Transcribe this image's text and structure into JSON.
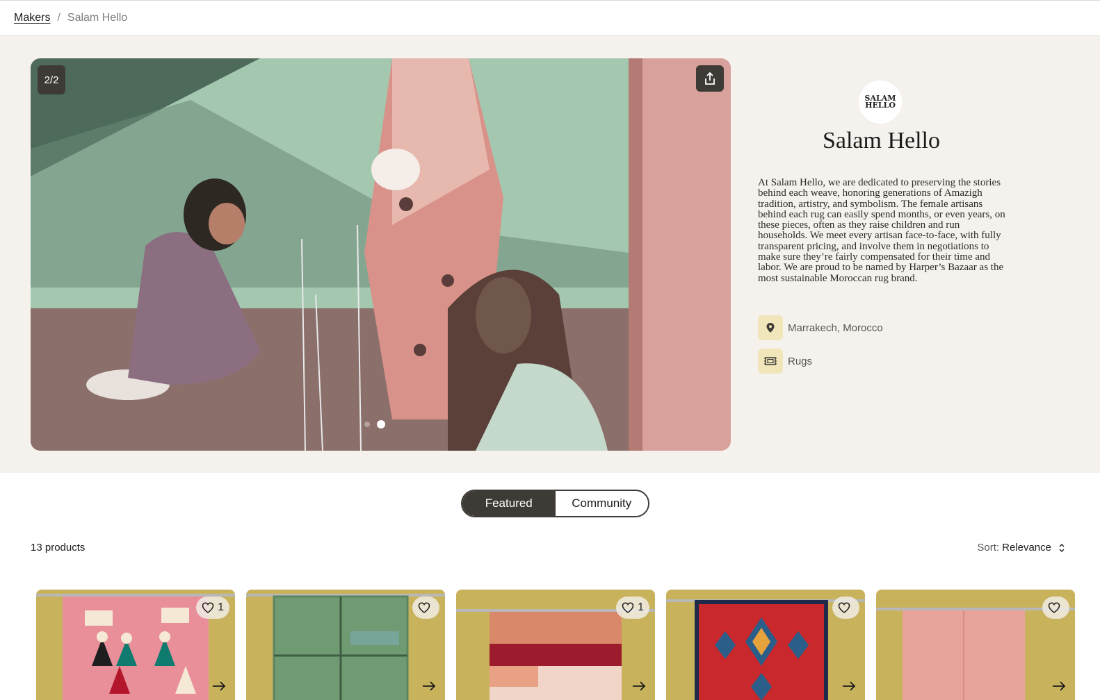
{
  "breadcrumb": {
    "parent": "Makers",
    "separator": "/",
    "current": "Salam Hello"
  },
  "gallery": {
    "counter": "2/2",
    "slides": 2,
    "active_slide": 2
  },
  "maker": {
    "logo_line1": "SALAM",
    "logo_line2": "HELLO",
    "name": "Salam Hello",
    "description": "At Salam Hello, we are dedicated to preserving the stories behind each weave, honoring generations of Amazigh tradition, artistry, and symbolism. The female artisans behind each rug can easily spend months, or even years, on these pieces, often as they raise children and run households. We meet every artisan face-to-face, with fully transparent pricing, and involve them in negotiations to make sure they’re fairly compensated for their time and labor. We are proud to be named by Harper’s Bazaar as the most sustainable Moroccan rug brand.",
    "location": "Marrakech, Morocco",
    "category": "Rugs"
  },
  "tabs": {
    "featured": "Featured",
    "community": "Community",
    "active": "Featured"
  },
  "listing": {
    "count": "13 products",
    "sort_label": "Sort:",
    "sort_value": "Relevance"
  },
  "products": [
    {
      "likes": "1",
      "rug_color": "#e98f9a"
    },
    {
      "likes": "",
      "rug_color": "#6f9a72"
    },
    {
      "likes": "1",
      "rug_color": "#d9896a"
    },
    {
      "likes": "",
      "rug_color": "#c9282c"
    },
    {
      "likes": "",
      "rug_color": "#e8a39a"
    }
  ],
  "colors": {
    "dark": "#3e3b37",
    "hero_bg": "#f5f2ed",
    "icon_bg": "#f0e6b9",
    "wall": "#c9b25c"
  }
}
